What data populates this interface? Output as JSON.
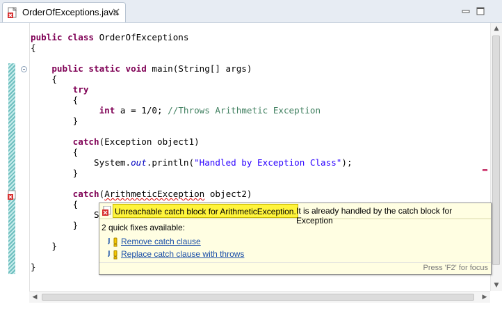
{
  "tab": {
    "title": "OrderOfExceptions.java"
  },
  "code": {
    "lines": [
      {
        "parts": [
          {
            "k": "kw",
            "t": "public class "
          },
          {
            "k": "",
            "t": "OrderOfExceptions"
          }
        ]
      },
      {
        "parts": [
          {
            "k": "",
            "t": "{"
          }
        ]
      },
      {
        "parts": [
          {
            "k": "",
            "t": ""
          }
        ]
      },
      {
        "parts": [
          {
            "k": "",
            "t": "    "
          },
          {
            "k": "kw",
            "t": "public static void "
          },
          {
            "k": "",
            "t": "main(String[] args)"
          }
        ]
      },
      {
        "parts": [
          {
            "k": "",
            "t": "    {"
          }
        ]
      },
      {
        "parts": [
          {
            "k": "",
            "t": "        "
          },
          {
            "k": "kw",
            "t": "try"
          }
        ]
      },
      {
        "parts": [
          {
            "k": "",
            "t": "        {"
          }
        ]
      },
      {
        "parts": [
          {
            "k": "",
            "t": "             "
          },
          {
            "k": "kw",
            "t": "int "
          },
          {
            "k": "",
            "t": "a = 1/0; "
          },
          {
            "k": "cm",
            "t": "//Throws Arithmetic Exception"
          }
        ]
      },
      {
        "parts": [
          {
            "k": "",
            "t": "        }"
          }
        ]
      },
      {
        "parts": [
          {
            "k": "",
            "t": ""
          }
        ]
      },
      {
        "parts": [
          {
            "k": "",
            "t": "        "
          },
          {
            "k": "kw",
            "t": "catch"
          },
          {
            "k": "",
            "t": "(Exception object1)"
          }
        ]
      },
      {
        "parts": [
          {
            "k": "",
            "t": "        {"
          }
        ]
      },
      {
        "parts": [
          {
            "k": "",
            "t": "            System."
          },
          {
            "k": "it",
            "t": "out"
          },
          {
            "k": "",
            "t": ".println("
          },
          {
            "k": "st",
            "t": "\"Handled by Exception Class\""
          },
          {
            "k": "",
            "t": ");"
          }
        ]
      },
      {
        "parts": [
          {
            "k": "",
            "t": "        }"
          }
        ]
      },
      {
        "parts": [
          {
            "k": "",
            "t": ""
          }
        ]
      },
      {
        "parts": [
          {
            "k": "",
            "t": "        "
          },
          {
            "k": "kw",
            "t": "catch"
          },
          {
            "k": "",
            "t": "("
          },
          {
            "k": "err",
            "t": "ArithmeticException"
          },
          {
            "k": "",
            "t": " object2)"
          }
        ]
      },
      {
        "parts": [
          {
            "k": "",
            "t": "        {"
          }
        ]
      },
      {
        "parts": [
          {
            "k": "",
            "t": "            Sy"
          }
        ]
      },
      {
        "parts": [
          {
            "k": "",
            "t": "        }"
          }
        ]
      },
      {
        "parts": [
          {
            "k": "",
            "t": ""
          }
        ]
      },
      {
        "parts": [
          {
            "k": "",
            "t": "    }"
          }
        ]
      },
      {
        "parts": [
          {
            "k": "",
            "t": ""
          }
        ]
      },
      {
        "parts": [
          {
            "k": "",
            "t": "}"
          }
        ]
      }
    ]
  },
  "popup": {
    "error_highlight": "Unreachable catch block for ArithmeticException.",
    "error_rest": "It is already handled by the catch block for Exception",
    "quick_fix_count": "2 quick fixes available:",
    "fixes": [
      {
        "label": "Remove catch clause"
      },
      {
        "label": "Replace catch clause with throws"
      }
    ],
    "footer": "Press 'F2' for focus"
  },
  "icons": {
    "tab_file": "java-file-error-icon",
    "tab_close": "close-icon",
    "minimize": "minimize-icon",
    "maximize": "maximize-icon",
    "error_marker": "error-marker-icon",
    "fold": "fold-collapse-icon",
    "fix": "quick-fix-icon"
  },
  "colors": {
    "keyword": "#7f0055",
    "comment": "#3f7f5f",
    "string": "#2a00ff",
    "field": "#0000c0",
    "popup_bg": "#fffee2",
    "error_highlight": "#fff43c",
    "link": "#1a4ea8"
  }
}
